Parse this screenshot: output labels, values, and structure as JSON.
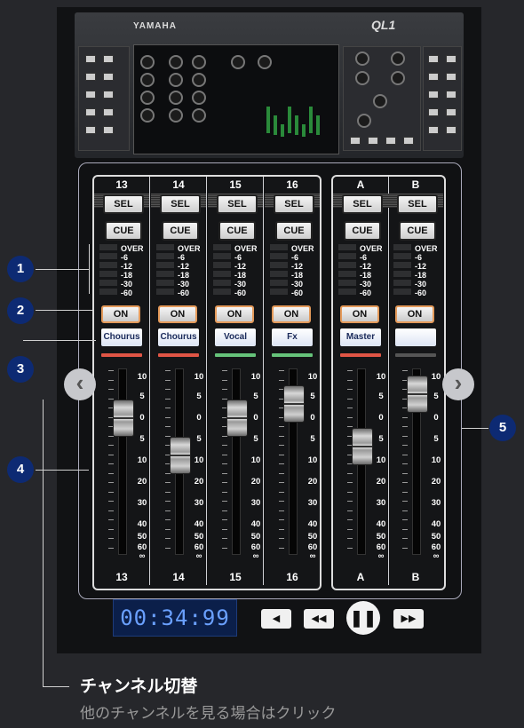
{
  "console": {
    "brand": "YAMAHA",
    "model": "QL1"
  },
  "banks": [
    {
      "strips": [
        {
          "number": "13",
          "name": "Chourus",
          "color": "#e05545",
          "fader_pos": 0.18
        },
        {
          "number": "14",
          "name": "Chourus",
          "color": "#e05545",
          "fader_pos": 0.38
        },
        {
          "number": "15",
          "name": "Vocal",
          "color": "#66c37a",
          "fader_pos": 0.18
        },
        {
          "number": "16",
          "name": "Fx",
          "color": "#66c37a",
          "fader_pos": 0.1
        }
      ]
    },
    {
      "strips": [
        {
          "number": "A",
          "name": "Master",
          "color": "#e05545",
          "fader_pos": 0.33
        },
        {
          "number": "B",
          "name": "",
          "color": "#555555",
          "fader_pos": 0.05
        }
      ]
    }
  ],
  "labels": {
    "sel": "SEL",
    "cue": "CUE",
    "on": "ON"
  },
  "meter_levels": [
    "OVER",
    "-6",
    "-12",
    "-18",
    "-30",
    "-60"
  ],
  "fader_scale": [
    "10",
    "5",
    "0",
    "5",
    "10",
    "20",
    "30",
    "40",
    "50",
    "60",
    "∞"
  ],
  "nav": {
    "prev": "‹",
    "next": "›"
  },
  "markers": [
    "1",
    "2",
    "3",
    "4",
    "5"
  ],
  "transport": {
    "time": "00:34:99",
    "prev": "◀",
    "rewind": "◀◀",
    "pause": "❚❚",
    "forward": "▶▶"
  },
  "caption": {
    "title": "チャンネル切替",
    "subtitle": "他のチャンネルを見る場合はクリック"
  }
}
